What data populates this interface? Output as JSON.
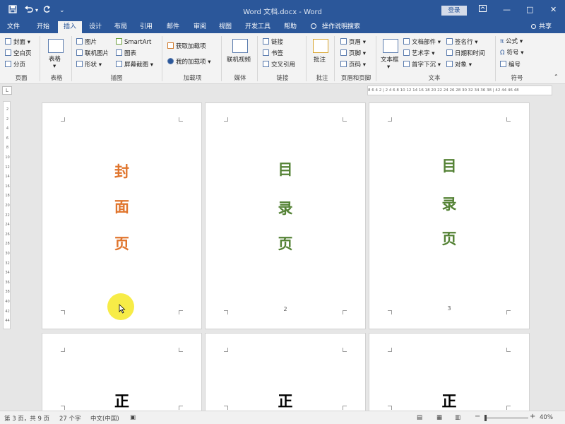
{
  "title_bar": {
    "document_title": "Word 文档.docx - Word",
    "login_label": "登录",
    "save_icon": "save-icon",
    "undo_icon": "undo-icon",
    "redo_icon": "redo-icon",
    "minimize": "—",
    "restore": "▢",
    "maximize": "□",
    "close": "✕"
  },
  "tabs": [
    "文件",
    "开始",
    "插入",
    "设计",
    "布局",
    "引用",
    "邮件",
    "审阅",
    "视图",
    "开发工具",
    "帮助"
  ],
  "active_tab": "插入",
  "tell_me": "操作说明搜索",
  "share": "共享",
  "ribbon": {
    "pages": {
      "items": [
        "封面",
        "空白页",
        "分页"
      ],
      "label": "页面"
    },
    "tables": {
      "button": "表格",
      "label": "表格"
    },
    "illustrations": {
      "items": [
        "图片",
        "联机图片",
        "形状",
        "SmartArt",
        "图表",
        "屏幕截图"
      ],
      "label": "插图"
    },
    "addins": {
      "items": [
        "获取加载项",
        "我的加载项"
      ],
      "label": "加载项"
    },
    "media": {
      "button": "联机视频",
      "label": "媒体"
    },
    "links": {
      "items": [
        "链接",
        "书签",
        "交叉引用"
      ],
      "label": "链接"
    },
    "comments": {
      "button": "批注",
      "label": "批注"
    },
    "header_footer": {
      "items": [
        "页眉",
        "页脚",
        "页码"
      ],
      "label": "页眉和页脚"
    },
    "text": {
      "textbox": "文本框",
      "items": [
        "文档部件",
        "艺术字",
        "首字下沉",
        "签名行",
        "日期和时间",
        "对象"
      ],
      "label": "文本"
    },
    "symbols": {
      "items": [
        "公式",
        "符号",
        "编号"
      ],
      "label": "符号"
    }
  },
  "ruler": {
    "h_text": "8  6  4  2  |  2  4  6  8  10 12 14 16 18 20 22 24 26 28 30 32 34 36 38  |  42 44 46 48",
    "corner": "L",
    "v_ticks": [
      "2",
      "2",
      "4",
      "6",
      "8",
      "10",
      "12",
      "14",
      "16",
      "18",
      "20",
      "22",
      "24",
      "26",
      "28",
      "30",
      "32",
      "34",
      "36",
      "38",
      "40",
      "42",
      "44"
    ]
  },
  "pages": [
    {
      "chars": [
        "封",
        "面",
        "页"
      ],
      "color": "#e0752d",
      "number": ""
    },
    {
      "chars": [
        "目",
        "录",
        "页"
      ],
      "color": "#548235",
      "number": "2"
    },
    {
      "chars": [
        "目",
        "录",
        "页"
      ],
      "color": "#548235",
      "number": "3"
    },
    {
      "chars": [
        "正"
      ],
      "color": "#000000",
      "number": ""
    },
    {
      "chars": [
        "正"
      ],
      "color": "#000000",
      "number": ""
    },
    {
      "chars": [
        "正"
      ],
      "color": "#000000",
      "number": ""
    }
  ],
  "status": {
    "page": "第 3 页，共 9 页",
    "words": "27 个字",
    "language": "中文(中国)",
    "zoom_minus": "−",
    "zoom_plus": "+",
    "zoom": "40%"
  },
  "colors": {
    "brand": "#2b579a",
    "highlight": "#f7ec47"
  }
}
